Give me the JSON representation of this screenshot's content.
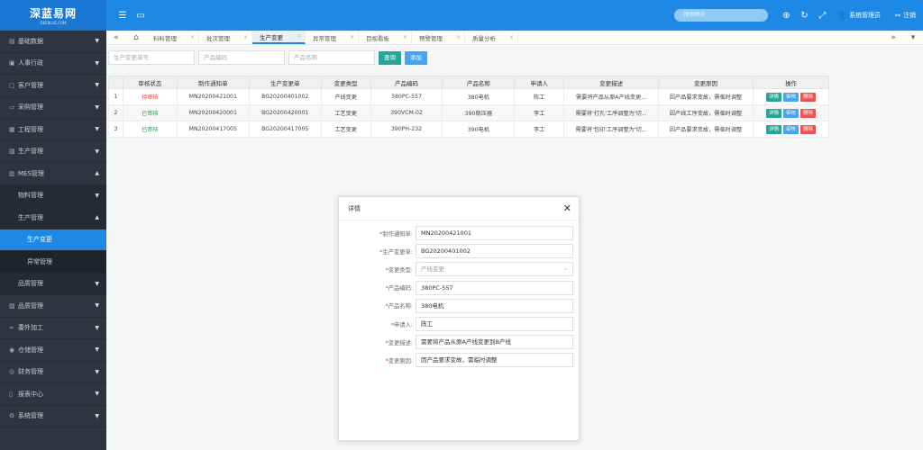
{
  "header": {
    "logo_text": "深蓝易网",
    "logo_sub": "DEEBLUE.COM",
    "search_placeholder": "搜索模块",
    "user_label": "系统管理员",
    "logout_label": "注销"
  },
  "sidebar": {
    "items": [
      {
        "label": "基础数据",
        "icon": "database-icon"
      },
      {
        "label": "人事行政",
        "icon": "people-icon"
      },
      {
        "label": "客户管理",
        "icon": "customer-icon"
      },
      {
        "label": "采购管理",
        "icon": "cart-icon"
      },
      {
        "label": "工程管理",
        "icon": "engineering-icon"
      },
      {
        "label": "生产管理",
        "icon": "production-icon"
      },
      {
        "label": "MES管理",
        "icon": "mes-icon"
      },
      {
        "label": "物料管理"
      },
      {
        "label": "生产管理"
      },
      {
        "label": "生产变更"
      },
      {
        "label": "异常管理"
      },
      {
        "label": "品质管理"
      },
      {
        "label": "品质管理",
        "icon": "quality-icon"
      },
      {
        "label": "委外加工",
        "icon": "link-icon"
      },
      {
        "label": "仓储管理",
        "icon": "warehouse-icon"
      },
      {
        "label": "财务管理",
        "icon": "finance-icon"
      },
      {
        "label": "报表中心",
        "icon": "report-icon"
      },
      {
        "label": "系统管理",
        "icon": "settings-icon"
      }
    ]
  },
  "tabs": {
    "items": [
      "料料管理",
      "批次管理",
      "生产变更",
      "异常管理",
      "目视看板",
      "预警管理",
      "质量分析"
    ],
    "active_index": 2
  },
  "filters": {
    "change_no_placeholder": "生产变更单号",
    "product_code_placeholder": "产品编码",
    "product_name_placeholder": "产品名称",
    "query_label": "查询",
    "add_label": "添加"
  },
  "table": {
    "headers": [
      "",
      "审核状态",
      "制作通知单",
      "生产变更单",
      "变更类型",
      "产品编码",
      "产品名称",
      "申请人",
      "变更描述",
      "变更原因",
      "操作"
    ],
    "rows": [
      {
        "no": "1",
        "status": "待审核",
        "status_color": "red",
        "notice": "MN20200421001",
        "change": "BG20200401002",
        "type": "产线变更",
        "code": "380PC-557",
        "name": "380电机",
        "applicant": "陈工",
        "desc": "需要将产品从原A产线变更...",
        "reason": "因产品要求变故，需临时调整"
      },
      {
        "no": "2",
        "status": "已审核",
        "status_color": "green",
        "notice": "MN20200420001",
        "change": "BG20200420001",
        "type": "工艺变更",
        "code": "390VCM-02",
        "name": "390稳压器",
        "applicant": "李工",
        "desc": "需要将'打孔'工序调整为'切...",
        "reason": "因产线工序变故，需临时调整"
      },
      {
        "no": "3",
        "status": "已审核",
        "status_color": "green",
        "notice": "MN20200417005",
        "change": "BG20200417005",
        "type": "工艺变更",
        "code": "390PH-232",
        "name": "390电机",
        "applicant": "李工",
        "desc": "需要将'包印'工序调整为'切...",
        "reason": "因产品要求变故，需临时调整"
      }
    ],
    "op_labels": {
      "detail": "详情",
      "audit": "审核",
      "delete": "删除"
    }
  },
  "modal": {
    "title": "详情",
    "fields": [
      {
        "label": "制作通知单:",
        "value": "MN20200421001",
        "select": false
      },
      {
        "label": "生产变更单:",
        "value": "BG20200401002",
        "select": false
      },
      {
        "label": "变更类型:",
        "value": "产线变更",
        "select": true
      },
      {
        "label": "产品编码:",
        "value": "380PC-557",
        "select": false
      },
      {
        "label": "产品名称:",
        "value": "380电机",
        "select": false
      },
      {
        "label": "申请人:",
        "value": "陈工",
        "select": false
      },
      {
        "label": "变更描述:",
        "value": "需要将产品从原A产线变更到B产线",
        "select": false
      },
      {
        "label": "变更原因:",
        "value": "因产品要求变故，需临时调整",
        "select": false
      }
    ]
  },
  "colors": {
    "primary": "#1e88e5",
    "sidebar": "#2f3440",
    "danger": "#ef5350",
    "success": "#26a69a"
  }
}
